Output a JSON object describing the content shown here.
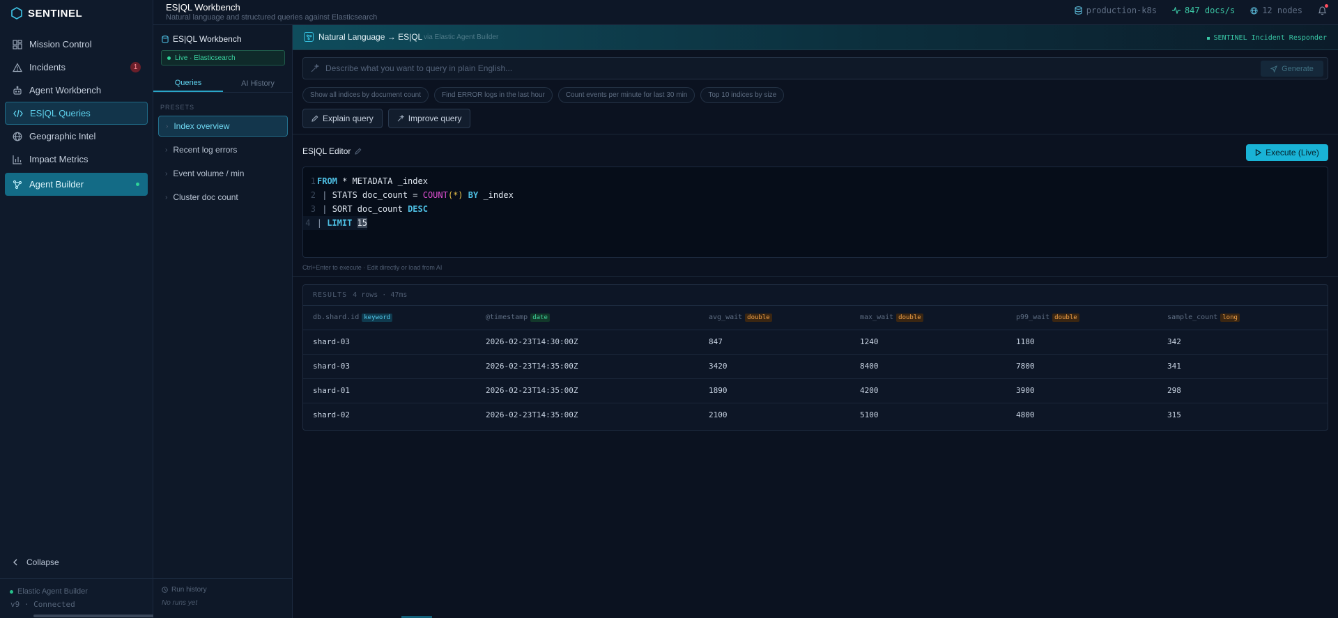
{
  "brand": {
    "name": "SENTINEL"
  },
  "nav": [
    {
      "label": "Mission Control",
      "icon": "dashboard-icon"
    },
    {
      "label": "Incidents",
      "icon": "warning-icon",
      "badge": "1"
    },
    {
      "label": "Agent Workbench",
      "icon": "robot-icon"
    },
    {
      "label": "ES|QL Queries",
      "icon": "code-icon",
      "active": true
    },
    {
      "label": "Geographic Intel",
      "icon": "globe-icon"
    },
    {
      "label": "Impact Metrics",
      "icon": "bar-chart-icon"
    },
    {
      "label": "Agent Builder",
      "icon": "network-icon",
      "highlight": true
    }
  ],
  "sidebar_footer": {
    "collapse_label": "Collapse",
    "agent_name": "Elastic Agent Builder",
    "status": "v9 · Connected"
  },
  "topbar": {
    "title": "ES|QL Workbench",
    "subtitle": "Natural language and structured queries against Elasticsearch",
    "cluster": "production-k8s",
    "rate": "847 docs/s",
    "nodes": "12 nodes"
  },
  "midpanel": {
    "title": "ES|QL Workbench",
    "live_label": "Live · Elasticsearch",
    "tabs": [
      "Queries",
      "AI History"
    ],
    "presets_label": "PRESETS",
    "presets": [
      "Index overview",
      "Recent log errors",
      "Event volume / min",
      "Cluster doc count"
    ],
    "run_history_label": "Run history",
    "no_runs": "No runs yet"
  },
  "nl": {
    "title": "Natural Language → ES|QL",
    "via": "via Elastic Agent Builder",
    "responder": "SENTINEL Incident Responder",
    "placeholder": "Describe what you want to query in plain English...",
    "generate_label": "Generate",
    "chips": [
      "Show all indices by document count",
      "Find ERROR logs in the last hour",
      "Count events per minute for last 30 min",
      "Top 10 indices by size"
    ],
    "explain_label": "Explain query",
    "improve_label": "Improve query"
  },
  "editor": {
    "label": "ES|QL Editor",
    "execute_label": "Execute (Live)",
    "hint": "Ctrl+Enter to execute · Edit directly or load from AI",
    "line_numbers": [
      "1",
      "2",
      "3",
      "4"
    ],
    "l1": {
      "kw": "FROM",
      "rest": " * METADATA _index"
    },
    "l2": {
      "pipe": "| ",
      "t1": "STATS doc_count = ",
      "fn": "COUNT",
      "args": "(*)",
      "kw": " BY",
      "t2": " _index"
    },
    "l3": {
      "pipe": "| ",
      "t1": "SORT doc_count ",
      "kw": "DESC"
    },
    "l4": {
      "pipe": "| ",
      "kw": "LIMIT",
      "sp": " ",
      "num": "15"
    }
  },
  "results": {
    "label": "RESULTS",
    "meta": "4 rows · 47ms",
    "columns": [
      {
        "name": "db.shard.id",
        "type": "keyword"
      },
      {
        "name": "@timestamp",
        "type": "date"
      },
      {
        "name": "avg_wait",
        "type": "double"
      },
      {
        "name": "max_wait",
        "type": "double"
      },
      {
        "name": "p99_wait",
        "type": "double"
      },
      {
        "name": "sample_count",
        "type": "long"
      }
    ],
    "rows": [
      [
        "shard-03",
        "2026-02-23T14:30:00Z",
        "847",
        "1240",
        "1180",
        "342"
      ],
      [
        "shard-03",
        "2026-02-23T14:35:00Z",
        "3420",
        "8400",
        "7800",
        "341"
      ],
      [
        "shard-01",
        "2026-02-23T14:35:00Z",
        "1890",
        "4200",
        "3900",
        "298"
      ],
      [
        "shard-02",
        "2026-02-23T14:35:00Z",
        "2100",
        "5100",
        "4800",
        "315"
      ]
    ]
  }
}
